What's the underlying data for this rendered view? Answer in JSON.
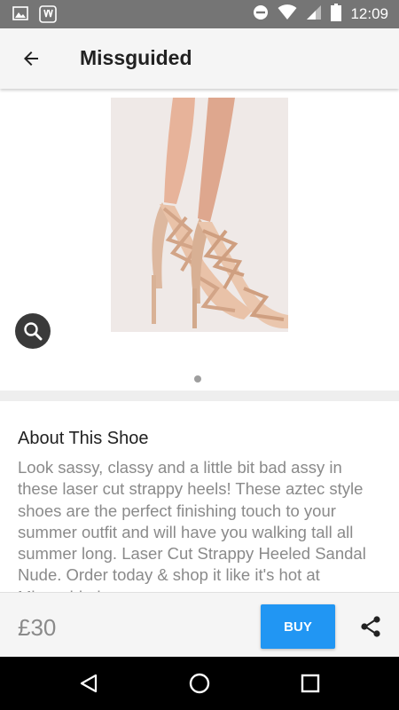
{
  "status_bar": {
    "time": "12:09",
    "icons": [
      "image-icon",
      "app-notification-icon",
      "do-not-disturb-icon",
      "wifi-icon",
      "signal-icon",
      "battery-icon"
    ]
  },
  "app_bar": {
    "title": "Missguided",
    "back_icon": "arrow-back-icon"
  },
  "product": {
    "image": "strappy-heeled-sandal-photo",
    "zoom_icon": "magnify-icon",
    "page_indicator": {
      "current": 1,
      "total": 1
    }
  },
  "about": {
    "heading": "About This Shoe",
    "description": "Look sassy, classy and a little bit bad assy in these laser cut strappy heels! These aztec style shoes are the perfect finishing touch to your summer outfit and will have you walking tall all summer long. Laser Cut Strappy Heeled Sandal Nude. Order today & shop it like it's hot at Missguided."
  },
  "purchase": {
    "price": "£30",
    "buy_label": "BUY",
    "share_icon": "share-icon"
  },
  "colors": {
    "status_bar": "#757575",
    "app_bar": "#f5f5f5",
    "accent": "#2196f3",
    "secondary_text": "#8a8a8a"
  },
  "nav_bar": {
    "icons": [
      "back-triangle-icon",
      "home-circle-icon",
      "recents-square-icon"
    ]
  }
}
